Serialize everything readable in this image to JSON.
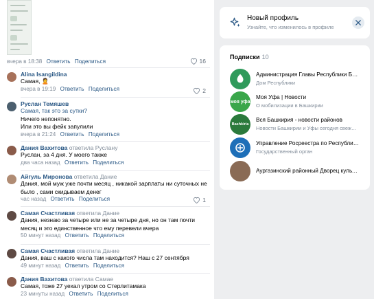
{
  "top_post": {
    "time": "вчера в 18:38",
    "reply_label": "Ответить",
    "share_label": "Поделиться",
    "likes": "16"
  },
  "comments": [
    {
      "author": "Alina Isangildina",
      "reply_word": "",
      "reply_to": "",
      "lines": [
        "Самая, 🙎"
      ],
      "time": "вчера в 19:19",
      "likes": "2"
    },
    {
      "author": "Руслан Темяшев",
      "reply_word": "",
      "reply_to": "",
      "lines": [
        "Самая, так это за сутки?",
        "Ничего непонятно.",
        "Или это вы фейк запулили"
      ],
      "time": "вчера в 21:24",
      "likes": ""
    },
    {
      "author": "Дания Вахитова",
      "reply_word": "ответила",
      "reply_to": "Руслану",
      "lines": [
        "Руслан, за 4 дня. У моего также"
      ],
      "time": "два часа назад",
      "likes": ""
    },
    {
      "author": "Айгуль Миронова",
      "reply_word": "ответила",
      "reply_to": "Дание",
      "lines": [
        "Дания, мой муж уже почти месяц , никакой зарплаты ни суточных не",
        "было , сами скидываем денег"
      ],
      "time": "час назад",
      "likes": "1"
    },
    {
      "author": "Самая Счастливая",
      "reply_word": "ответила",
      "reply_to": "Дание",
      "lines": [
        "Дания, незнаю за четыре или не за четыре дня, но он там почти",
        "месяц и это единственное что ему перевели вчера"
      ],
      "time": "50 минут назад",
      "likes": ""
    },
    {
      "author": "Самая Счастливая",
      "reply_word": "ответила",
      "reply_to": "Дание",
      "lines": [
        "Дания, ваш с какого числа там находится? Наш с 27 сентября"
      ],
      "time": "49 минут назад",
      "likes": ""
    },
    {
      "author": "Дания Вахитова",
      "reply_word": "ответила",
      "reply_to": "Самае",
      "lines": [
        "Самая, тоже 27 уехал утром со Стерлитамака"
      ],
      "time": "23 минуты назад",
      "likes": ""
    }
  ],
  "labels": {
    "reply": "Ответить",
    "share": "Поделиться"
  },
  "new_profile": {
    "title": "Новый профиль",
    "subtitle": "Узнайте, что изменилось в профиле"
  },
  "subscriptions": {
    "title": "Подписки",
    "count": "10",
    "items": [
      {
        "name": "Администрация Главы Республики Ба…",
        "desc": "Дом Республики",
        "avatar_color": "#2f9a5b",
        "avatar_text": ""
      },
      {
        "name": "Моя Уфа | Новости",
        "desc": "О мобилизации в Башкирии",
        "avatar_color": "#3aa64a",
        "avatar_text": "моя уфа"
      },
      {
        "name": "Вся Башкирия - новости районов",
        "desc": "Новости Башкирии и Уфы сегодня свежи…",
        "avatar_color": "#2b7a3c",
        "avatar_text": "Bashkiria"
      },
      {
        "name": "Управление Росреестра по Республик…",
        "desc": "Государственный орган",
        "avatar_color": "#1e6fb8",
        "avatar_text": ""
      },
      {
        "name": "Аургазинский районный Дворец культ…",
        "desc": "",
        "avatar_color": "#8a6b55",
        "avatar_text": ""
      }
    ]
  }
}
